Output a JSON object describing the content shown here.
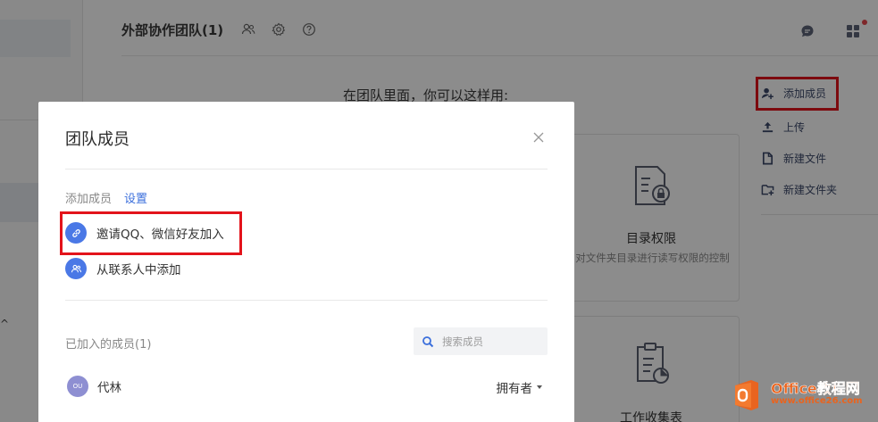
{
  "header": {
    "team_title": "外部协作团队(1)",
    "icons": [
      "members-icon",
      "gear-icon",
      "help-icon"
    ]
  },
  "top_right": {
    "icons": [
      "chat-icon",
      "apps-grid-icon"
    ]
  },
  "intro_text": "在团队里面，你可以这样用:",
  "right_menu": {
    "items": [
      {
        "label": "添加成员",
        "icon": "add-member-icon"
      },
      {
        "label": "上传",
        "icon": "upload-icon"
      },
      {
        "label": "新建文件",
        "icon": "new-file-icon"
      },
      {
        "label": "新建文件夹",
        "icon": "new-folder-icon"
      }
    ]
  },
  "cards": [
    {
      "title": "目录权限",
      "desc": "对文件夹目录进行读写权限的控制",
      "icon": "directory-lock-icon"
    },
    {
      "title": "工作收集表",
      "icon": "clipboard-chart-icon"
    }
  ],
  "modal": {
    "title": "团队成员",
    "add_section_label": "添加成员",
    "settings_link": "设置",
    "options": [
      {
        "label": "邀请QQ、微信好友加入",
        "icon": "link-icon"
      },
      {
        "label": "从联系人中添加",
        "icon": "contacts-icon"
      }
    ],
    "joined_label": "已加入的成员(1)",
    "search_placeholder": "搜索成员",
    "members": [
      {
        "avatar_text": "OU",
        "name": "代林",
        "role": "拥有者"
      }
    ]
  },
  "watermark": {
    "big": "Office教程网",
    "small": "www.office26.com"
  },
  "left_glyph": "^",
  "colors": {
    "accent": "#4a78e6",
    "highlight": "#e3131b",
    "link": "#3b6fdc"
  }
}
